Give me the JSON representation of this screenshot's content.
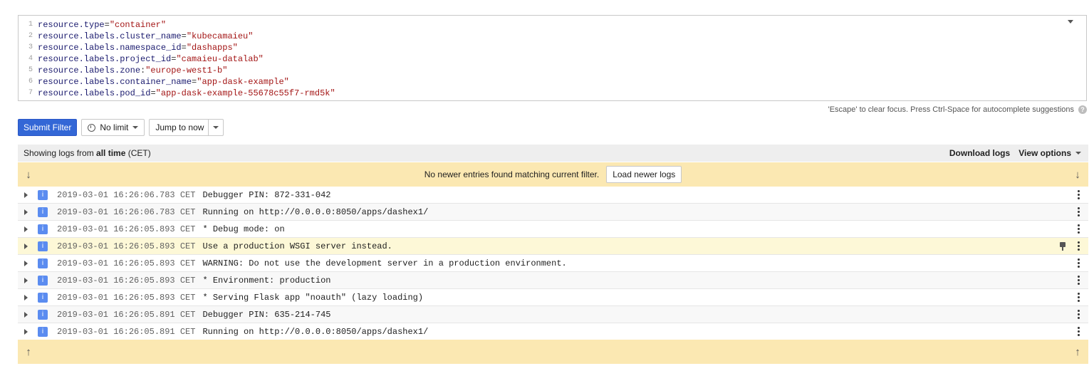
{
  "editor": {
    "lines": [
      {
        "num": "1",
        "key": "resource.type",
        "op": "=",
        "value": "\"container\""
      },
      {
        "num": "2",
        "key": "resource.labels.cluster_name",
        "op": "=",
        "value": "\"kubecamaieu\""
      },
      {
        "num": "3",
        "key": "resource.labels.namespace_id",
        "op": "=",
        "value": "\"dashapps\""
      },
      {
        "num": "4",
        "key": "resource.labels.project_id",
        "op": "=",
        "value": "\"camaieu-datalab\""
      },
      {
        "num": "5",
        "key": "resource.labels.zone",
        "op": ":",
        "value": "\"europe-west1-b\""
      },
      {
        "num": "6",
        "key": "resource.labels.container_name",
        "op": "=",
        "value": "\"app-dask-example\""
      },
      {
        "num": "7",
        "key": "resource.labels.pod_id",
        "op": "=",
        "value": "\"app-dask-example-55678c55f7-rmd5k\""
      }
    ],
    "hint": "'Escape' to clear focus. Press Ctrl-Space for autocomplete suggestions",
    "help_glyph": "?"
  },
  "toolbar": {
    "submit_label": "Submit Filter",
    "limit_label": "No limit",
    "jump_label": "Jump to now"
  },
  "log_header": {
    "prefix": "Showing logs from ",
    "range": "all time",
    "tz": " (CET)",
    "download_label": "Download logs",
    "view_options_label": "View options"
  },
  "banner": {
    "message": "No newer entries found matching current filter.",
    "load_newer_label": "Load newer logs",
    "down_arrow": "↓",
    "up_arrow": "↑"
  },
  "logs": [
    {
      "sev": "i",
      "ts": "2019-03-01 16:26:06.783 CET",
      "msg": "Debugger PIN: 872-331-042"
    },
    {
      "sev": "i",
      "ts": "2019-03-01 16:26:06.783 CET",
      "msg": "Running on http://0.0.0.0:8050/apps/dashex1/"
    },
    {
      "sev": "i",
      "ts": "2019-03-01 16:26:05.893 CET",
      "msg": "* Debug mode: on"
    },
    {
      "sev": "i",
      "ts": "2019-03-01 16:26:05.893 CET",
      "msg": "Use a production WSGI server instead."
    },
    {
      "sev": "i",
      "ts": "2019-03-01 16:26:05.893 CET",
      "msg": "WARNING: Do not use the development server in a production environment."
    },
    {
      "sev": "i",
      "ts": "2019-03-01 16:26:05.893 CET",
      "msg": "* Environment: production"
    },
    {
      "sev": "i",
      "ts": "2019-03-01 16:26:05.893 CET",
      "msg": "* Serving Flask app \"noauth\" (lazy loading)"
    },
    {
      "sev": "i",
      "ts": "2019-03-01 16:26:05.891 CET",
      "msg": "Debugger PIN: 635-214-745"
    },
    {
      "sev": "i",
      "ts": "2019-03-01 16:26:05.891 CET",
      "msg": "Running on http://0.0.0.0:8050/apps/dashex1/"
    }
  ]
}
